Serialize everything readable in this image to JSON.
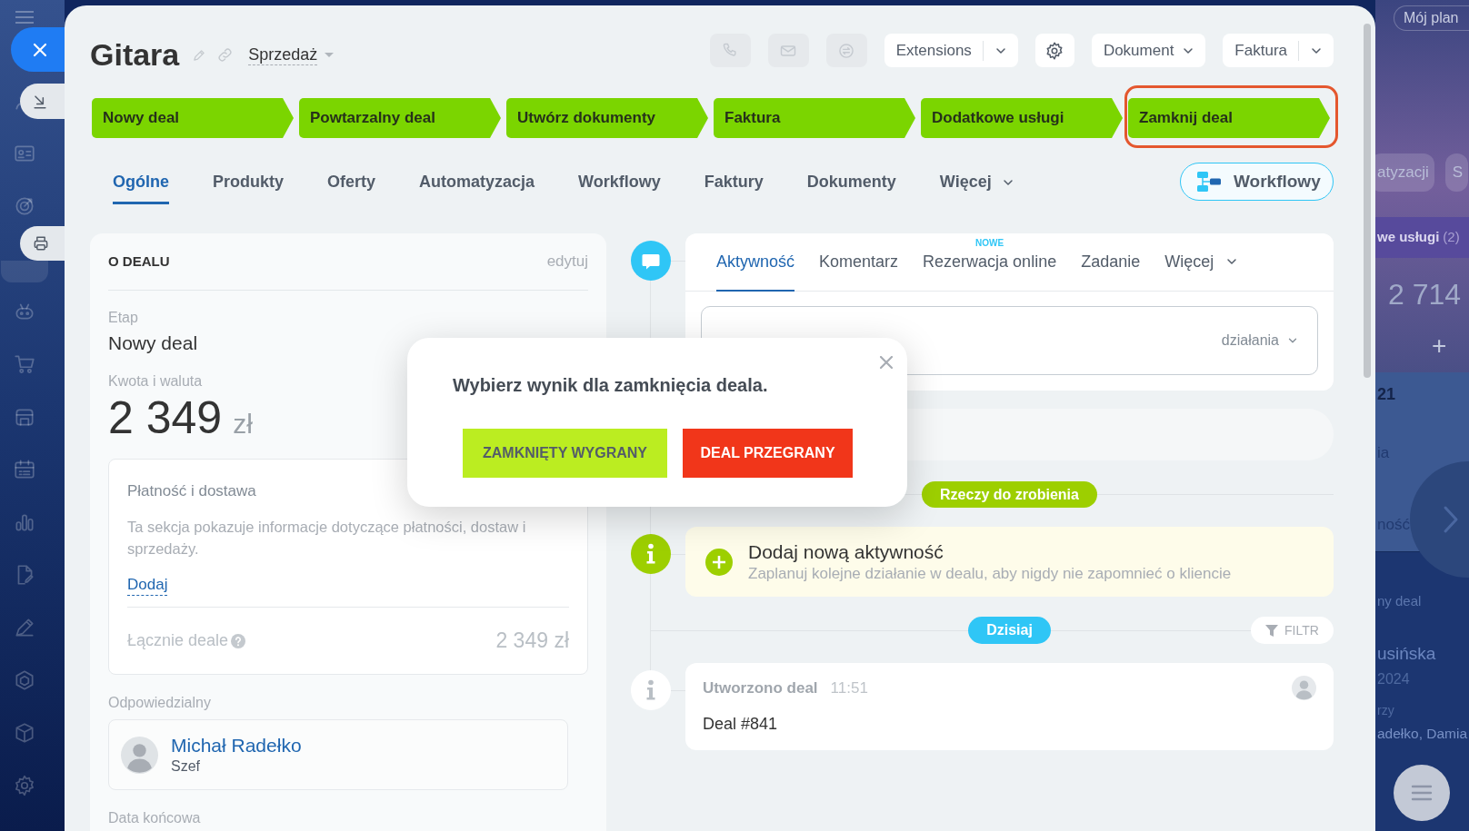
{
  "sidebar": {
    "items": [
      {
        "selected": false
      },
      {
        "selected": false
      },
      {
        "selected": false
      },
      {
        "selected": true
      },
      {
        "selected": false
      },
      {
        "selected": false
      },
      {
        "selected": false
      },
      {
        "selected": false
      },
      {
        "selected": false
      },
      {
        "selected": false
      },
      {
        "selected": false
      },
      {
        "selected": false
      },
      {
        "selected": false
      },
      {
        "selected": false
      }
    ]
  },
  "header": {
    "title": "Gitara",
    "category": "Sprzedaż",
    "contact_buttons": [
      {
        "disabled": true
      },
      {
        "disabled": true
      },
      {
        "disabled": true
      }
    ],
    "toolbar": [
      {
        "kind": "split",
        "label": "Extensions"
      },
      {
        "kind": "settings"
      },
      {
        "kind": "dropdown",
        "label": "Dokument"
      },
      {
        "kind": "split",
        "label": "Faktura"
      }
    ]
  },
  "stages": [
    {
      "label": "Nowy deal",
      "reached": true,
      "highlighted": false
    },
    {
      "label": "Powtarzalny deal",
      "reached": true,
      "highlighted": false
    },
    {
      "label": "Utwórz dokumenty",
      "reached": true,
      "highlighted": false
    },
    {
      "label": "Faktura",
      "reached": true,
      "highlighted": false
    },
    {
      "label": "Dodatkowe usługi",
      "reached": true,
      "highlighted": false
    },
    {
      "label": "Zamknij deal",
      "reached": true,
      "highlighted": true
    }
  ],
  "tabs": [
    {
      "label": "Ogólne",
      "selected": true,
      "has_menu": false
    },
    {
      "label": "Produkty",
      "selected": false,
      "has_menu": false
    },
    {
      "label": "Oferty",
      "selected": false,
      "has_menu": false
    },
    {
      "label": "Automatyzacja",
      "selected": false,
      "has_menu": false
    },
    {
      "label": "Workflowy",
      "selected": false,
      "has_menu": false
    },
    {
      "label": "Faktury",
      "selected": false,
      "has_menu": false
    },
    {
      "label": "Dokumenty",
      "selected": false,
      "has_menu": false
    },
    {
      "label": "Więcej",
      "selected": false,
      "has_menu": true
    }
  ],
  "workflow_button": {
    "label": "Workflowy"
  },
  "deal_card": {
    "title": "O DEALU",
    "edit_label": "edytuj",
    "stage_label": "Etap",
    "stage_value": "Nowy deal",
    "amount_label": "Kwota i waluta",
    "amount": "2 349",
    "currency": "zł",
    "payment": {
      "title": "Płatność i dostawa",
      "description": "Ta sekcja pokazuje informacje dotyczące płatności, dostaw i sprzedaży.",
      "add_label": "Dodaj",
      "total_label": "Łącznie deale",
      "total_value": "2 349 zł"
    },
    "responsible_label": "Odpowiedzialny",
    "responsible": {
      "name": "Michał Radełko",
      "position": "Szef"
    },
    "end_date_label": "Data końcowa"
  },
  "timeline": {
    "composer": {
      "tabs": [
        {
          "label": "Aktywność",
          "selected": true,
          "has_menu": false
        },
        {
          "label": "Komentarz",
          "selected": false,
          "has_menu": false
        },
        {
          "label": "Rezerwacja online",
          "selected": false,
          "has_menu": false,
          "badge": "NOWE"
        },
        {
          "label": "Zadanie",
          "selected": false,
          "has_menu": false
        },
        {
          "label": "Więcej",
          "selected": false,
          "has_menu": true
        }
      ],
      "actions_label": "działania"
    },
    "todo_label": "Rzeczy do zrobienia",
    "add_activity": {
      "title": "Dodaj nową aktywność",
      "subtitle": "Zaplanuj kolejne działanie w dealu, aby nigdy nie zapomnieć o kliencie"
    },
    "day_label": "Dzisiaj",
    "filter_label": "FILTR",
    "entries": [
      {
        "title": "Utworzono deal",
        "time": "11:51",
        "text": "Deal #841"
      }
    ]
  },
  "dialog": {
    "title": "Wybierz wynik dla zamknięcia deala.",
    "buttons": [
      {
        "kind": "win",
        "label": "ZAMKNIĘTY WYGRANY"
      },
      {
        "kind": "lose",
        "label": "DEAL PRZEGRANY"
      }
    ]
  },
  "background_board": {
    "plan_button": "Mój plan",
    "filter_chips": [
      "atyzacji",
      "S"
    ],
    "column_title": "we usługi",
    "column_count": "(2)",
    "column_total": "2 714",
    "add_sign": "+",
    "cards": [
      {
        "lines": [
          "21",
          "ia",
          "ność"
        ]
      },
      {
        "lines": [
          "ny deal",
          "usińska",
          "2024",
          "rzy",
          "adełko, Damia"
        ]
      }
    ]
  }
}
